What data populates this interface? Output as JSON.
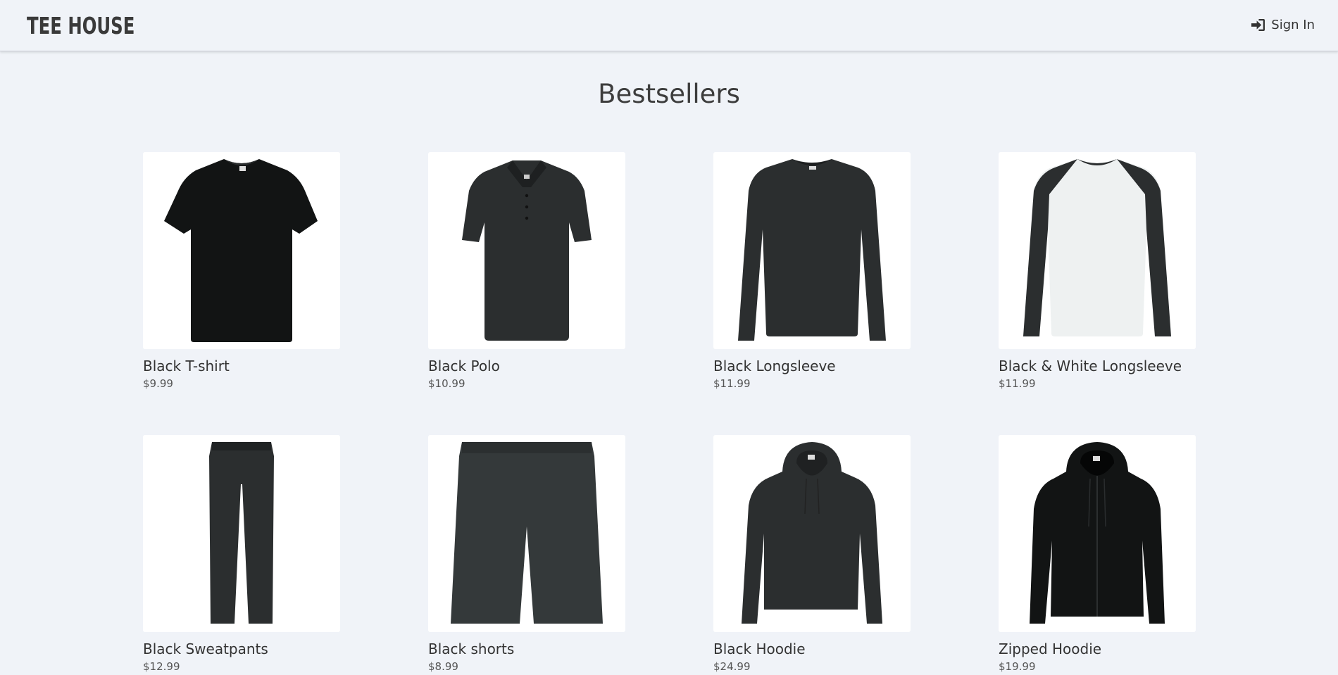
{
  "header": {
    "logo": "TEE HOUSE",
    "signin_label": "Sign In"
  },
  "page": {
    "title": "Bestsellers"
  },
  "products": [
    {
      "name": "Black T-shirt",
      "price": "$9.99",
      "icon": "tshirt-icon"
    },
    {
      "name": "Black Polo",
      "price": "$10.99",
      "icon": "polo-icon"
    },
    {
      "name": "Black Longsleeve",
      "price": "$11.99",
      "icon": "longsleeve-icon"
    },
    {
      "name": "Black & White Longsleeve",
      "price": "$11.99",
      "icon": "raglan-longsleeve-icon"
    },
    {
      "name": "Black Sweatpants",
      "price": "$12.99",
      "icon": "sweatpants-icon"
    },
    {
      "name": "Black shorts",
      "price": "$8.99",
      "icon": "shorts-icon"
    },
    {
      "name": "Black Hoodie",
      "price": "$24.99",
      "icon": "hoodie-icon"
    },
    {
      "name": "Zipped Hoodie",
      "price": "$19.99",
      "icon": "zip-hoodie-icon"
    }
  ],
  "colors": {
    "background": "#f0f3f8",
    "card": "#ffffff",
    "garment_dark": "#2b2e2f",
    "garment_black": "#121414",
    "text": "#333333"
  }
}
